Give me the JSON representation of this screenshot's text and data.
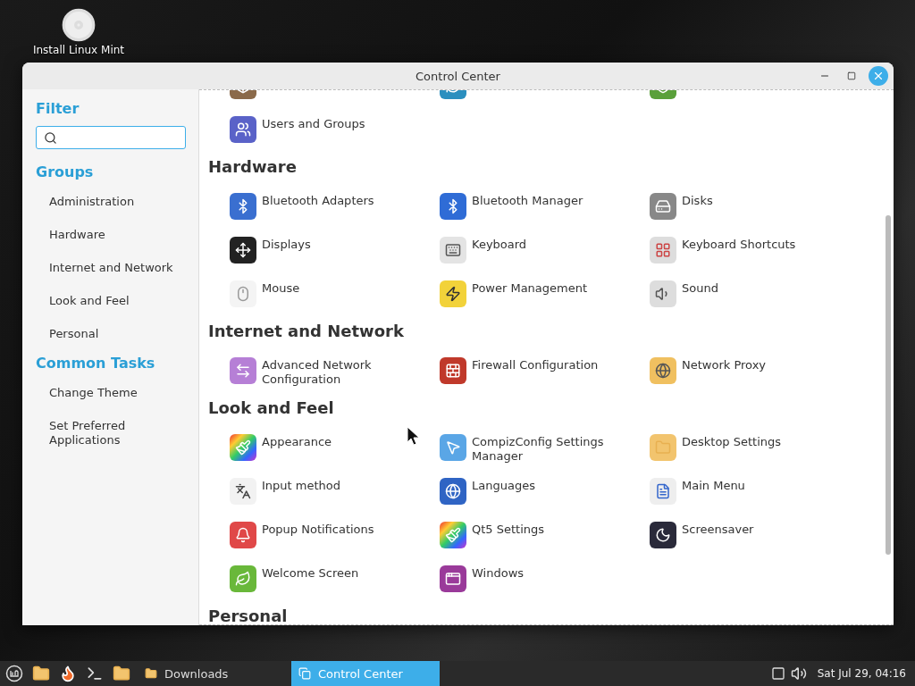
{
  "desktop": {
    "icons": [
      {
        "label": "Install Linux Mint"
      }
    ]
  },
  "window": {
    "title": "Control Center"
  },
  "sidebar": {
    "filter": {
      "heading": "Filter"
    },
    "groups": {
      "heading": "Groups",
      "items": [
        {
          "label": "Administration"
        },
        {
          "label": "Hardware"
        },
        {
          "label": "Internet and Network"
        },
        {
          "label": "Look and Feel"
        },
        {
          "label": "Personal"
        }
      ]
    },
    "common_tasks": {
      "heading": "Common Tasks",
      "items": [
        {
          "label": "Change Theme"
        },
        {
          "label": "Set Preferred Applications"
        }
      ]
    }
  },
  "sections": [
    {
      "items": [
        {
          "kind": "cut"
        },
        {
          "kind": "cut"
        },
        {
          "kind": "cut"
        },
        {
          "kind": "app",
          "label": "Users and Groups"
        }
      ]
    },
    {
      "title": "Hardware",
      "items": [
        {
          "kind": "app",
          "label": "Bluetooth Adapters"
        },
        {
          "kind": "app",
          "label": "Bluetooth Manager"
        },
        {
          "kind": "app",
          "label": "Disks"
        },
        {
          "kind": "app",
          "label": "Displays"
        },
        {
          "kind": "app",
          "label": "Keyboard"
        },
        {
          "kind": "app",
          "label": "Keyboard Shortcuts"
        },
        {
          "kind": "app",
          "label": "Mouse"
        },
        {
          "kind": "app",
          "label": "Power Management"
        },
        {
          "kind": "app",
          "label": "Sound"
        }
      ]
    },
    {
      "title": "Internet and Network",
      "items": [
        {
          "kind": "app",
          "label": "Advanced Network Configuration"
        },
        {
          "kind": "app",
          "label": "Firewall Configuration"
        },
        {
          "kind": "app",
          "label": "Network Proxy"
        }
      ]
    },
    {
      "title": "Look and Feel",
      "items": [
        {
          "kind": "app",
          "label": "Appearance"
        },
        {
          "kind": "app",
          "label": "CompizConfig Settings Manager"
        },
        {
          "kind": "app",
          "label": "Desktop Settings"
        },
        {
          "kind": "app",
          "label": "Input method"
        },
        {
          "kind": "app",
          "label": "Languages"
        },
        {
          "kind": "app",
          "label": "Main Menu"
        },
        {
          "kind": "app",
          "label": "Popup Notifications"
        },
        {
          "kind": "app",
          "label": "Qt5 Settings"
        },
        {
          "kind": "app",
          "label": "Screensaver"
        },
        {
          "kind": "app",
          "label": "Welcome Screen"
        },
        {
          "kind": "app",
          "label": "Windows"
        }
      ]
    },
    {
      "title": "Personal"
    }
  ],
  "taskbar": {
    "windows": [
      {
        "label": "Downloads",
        "selected": false
      },
      {
        "label": "Control Center",
        "selected": true
      }
    ],
    "clock": "Sat Jul 29, 04:16"
  }
}
